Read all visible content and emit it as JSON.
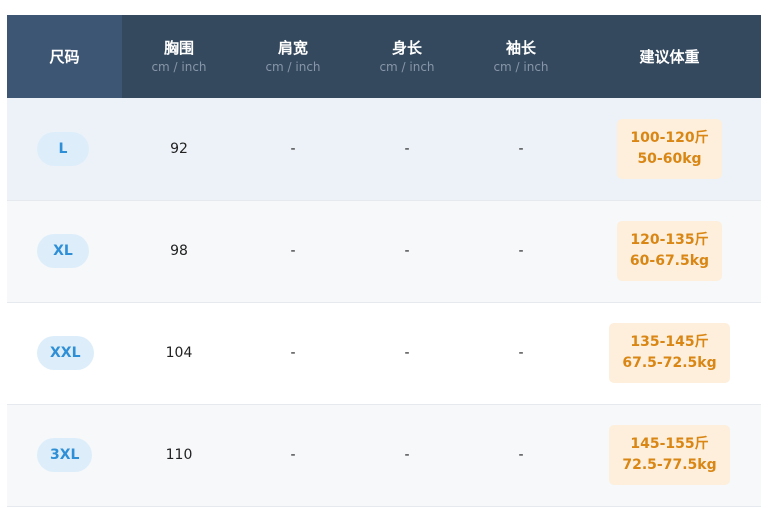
{
  "header": {
    "size": "尺码",
    "chest": "胸围",
    "shoulder": "肩宽",
    "length": "身长",
    "sleeve": "袖长",
    "weight": "建议体重",
    "unit": "cm / inch"
  },
  "rows": [
    {
      "size": "L",
      "chest": "92",
      "shoulder": "-",
      "length": "-",
      "sleeve": "-",
      "weight_jin": "100-120斤",
      "weight_kg": "50-60kg"
    },
    {
      "size": "XL",
      "chest": "98",
      "shoulder": "-",
      "length": "-",
      "sleeve": "-",
      "weight_jin": "120-135斤",
      "weight_kg": "60-67.5kg"
    },
    {
      "size": "XXL",
      "chest": "104",
      "shoulder": "-",
      "length": "-",
      "sleeve": "-",
      "weight_jin": "135-145斤",
      "weight_kg": "67.5-72.5kg"
    },
    {
      "size": "3XL",
      "chest": "110",
      "shoulder": "-",
      "length": "-",
      "sleeve": "-",
      "weight_jin": "145-155斤",
      "weight_kg": "72.5-77.5kg"
    }
  ],
  "colors": {
    "header_bg": "#34495e",
    "size_pill_bg": "#ddeefa",
    "size_pill_text": "#2f8fd6",
    "weight_badge_bg": "#fdefdc",
    "weight_badge_text": "#d98614"
  }
}
